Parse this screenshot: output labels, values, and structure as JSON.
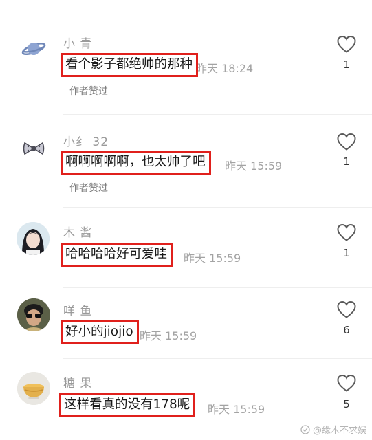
{
  "comments": [
    {
      "username": "小  青",
      "text": "看个影子都绝帅的那种",
      "time": "昨天 18:24",
      "author_liked": "作者赞过",
      "likes": "1",
      "avatar_icon": "saturn-icon"
    },
    {
      "username": "小纟              32",
      "text": "啊啊啊啊啊，也太帅了吧",
      "time": "昨天 15:59",
      "author_liked": "作者赞过",
      "likes": "1",
      "avatar_icon": "bow-icon"
    },
    {
      "username": "木   酱",
      "text": "哈哈哈哈好可爱哇",
      "time": "昨天 15:59",
      "likes": "1",
      "avatar_icon": "girl-photo-avatar"
    },
    {
      "username": "咩       鱼",
      "text": "好小的jiojio",
      "time": "昨天 15:59",
      "likes": "6",
      "avatar_icon": "person-photo-avatar"
    },
    {
      "username": "糖       果",
      "text": "这样看真的没有178呢",
      "time": "昨天 15:59",
      "likes": "5",
      "avatar_icon": "bowl-icon"
    }
  ],
  "watermark": "@缘木不求娱",
  "colors": {
    "highlight_border": "#e0201c",
    "username": "#9a9a9a",
    "timestamp": "#a3a3a3"
  }
}
